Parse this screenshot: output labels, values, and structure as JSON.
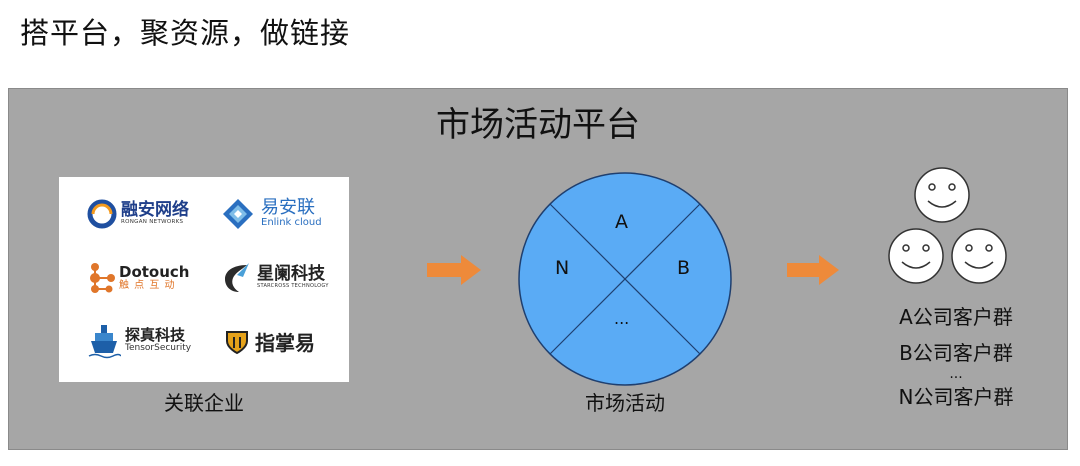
{
  "slide_title": "搭平台，聚资源，做链接",
  "platform_title": "市场活动平台",
  "logos": {
    "rongan": {
      "name": "融安网络",
      "sub": "RONGAN NETWORKS"
    },
    "enlink": {
      "name": "易安联",
      "sub": "Enlink cloud"
    },
    "dotouch": {
      "name": "Dotouch",
      "sub": "触 点 互 动"
    },
    "xinglan": {
      "name": "星阑科技",
      "sub": "STARCROSS TECHNOLOGY"
    },
    "tanzhen": {
      "name": "探真科技",
      "sub": "TensorSecurity"
    },
    "zhizhangyi": {
      "name": "指掌易"
    }
  },
  "captions": {
    "related": "关联企业",
    "activity": "市场活动",
    "groups": [
      "A公司客户群",
      "B公司客户群",
      "...",
      "N公司客户群"
    ]
  },
  "circle": {
    "top": "A",
    "right": "B",
    "left": "N",
    "bottom": "..."
  },
  "colors": {
    "platform_bg": "#a6a6a6",
    "circle_fill": "#5aabf5",
    "arrow": "#ee8a3a"
  }
}
